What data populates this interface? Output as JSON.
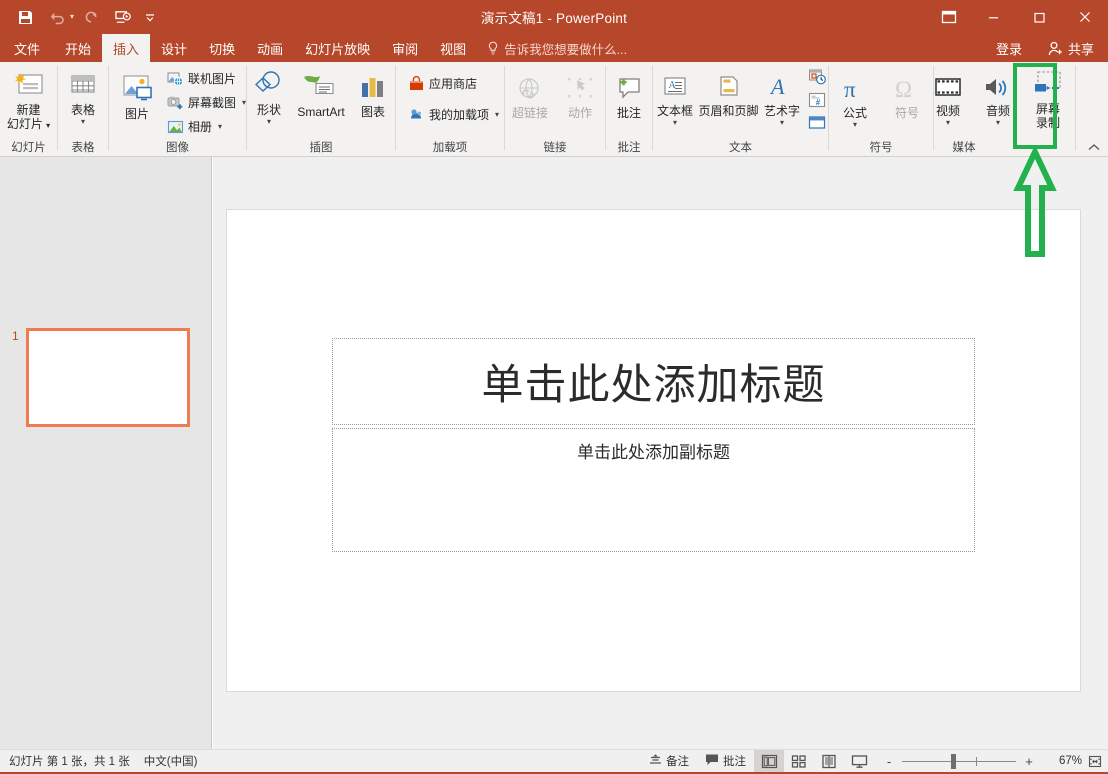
{
  "window": {
    "title": "演示文稿1 - PowerPoint",
    "accent_color": "#b7472a",
    "quick_access": [
      {
        "name": "save-button",
        "icon": "save-icon",
        "enabled": true
      },
      {
        "name": "undo-button",
        "icon": "undo-icon",
        "enabled": false
      },
      {
        "name": "redo-button",
        "icon": "redo-icon",
        "enabled": false
      },
      {
        "name": "start-from-beginning-button",
        "icon": "slideshow-icon",
        "enabled": true
      },
      {
        "name": "customize-quick-access-toolbar",
        "icon": "chevron-down-icon",
        "enabled": true
      }
    ],
    "controls": {
      "ribbon_display_options": "ribbon-display-options-icon",
      "minimize": "minimize-icon",
      "maximize": "maximize-icon",
      "close": "close-icon"
    }
  },
  "tabs": [
    {
      "label": "文件",
      "active": false
    },
    {
      "label": "开始",
      "active": false
    },
    {
      "label": "插入",
      "active": true
    },
    {
      "label": "设计",
      "active": false
    },
    {
      "label": "切换",
      "active": false
    },
    {
      "label": "动画",
      "active": false
    },
    {
      "label": "幻灯片放映",
      "active": false
    },
    {
      "label": "审阅",
      "active": false
    },
    {
      "label": "视图",
      "active": false
    }
  ],
  "tell_me": {
    "label": "告诉我您想要做什么...",
    "icon": "lightbulb-icon"
  },
  "account": {
    "signin_label": "登录",
    "share_label": "共享",
    "share_icon": "share-person-icon"
  },
  "ribbon": {
    "collapse_icon": "chevron-up-icon",
    "groups": [
      {
        "label": "幻灯片",
        "name": "ribbon-group-slides",
        "buttons": [
          {
            "name": "new-slide-button",
            "label1": "新建",
            "label2": "幻灯片",
            "icon": "new-slide-icon",
            "dropdown": true,
            "enabled": true
          }
        ]
      },
      {
        "label": "表格",
        "name": "ribbon-group-tables",
        "buttons": [
          {
            "name": "table-button",
            "label1": "表格",
            "label2": "",
            "icon": "table-icon",
            "dropdown": true,
            "enabled": true
          }
        ]
      },
      {
        "label": "图像",
        "name": "ribbon-group-images",
        "buttons": [
          {
            "name": "pictures-button",
            "label1": "图片",
            "label2": "",
            "icon": "picture-icon",
            "dropdown": false,
            "enabled": true
          }
        ],
        "small_buttons": [
          {
            "name": "online-pictures-button",
            "label": "联机图片",
            "icon": "online-pictures-icon",
            "dropdown": false
          },
          {
            "name": "screenshot-button",
            "label": "屏幕截图",
            "icon": "screenshot-icon",
            "dropdown": true
          },
          {
            "name": "photo-album-button",
            "label": "相册",
            "icon": "photo-album-icon",
            "dropdown": true
          }
        ]
      },
      {
        "label": "插图",
        "name": "ribbon-group-illustrations",
        "buttons": [
          {
            "name": "shapes-button",
            "label1": "形状",
            "label2": "",
            "icon": "shapes-icon",
            "dropdown": true,
            "enabled": true
          },
          {
            "name": "smartart-button",
            "label1": "SmartArt",
            "label2": "",
            "icon": "smartart-icon",
            "dropdown": false,
            "enabled": true
          },
          {
            "name": "chart-button",
            "label1": "图表",
            "label2": "",
            "icon": "chart-icon",
            "dropdown": false,
            "enabled": true
          }
        ]
      },
      {
        "label": "加载项",
        "name": "ribbon-group-addins",
        "small_buttons": [
          {
            "name": "store-button",
            "label": "应用商店",
            "icon": "store-icon",
            "dropdown": false
          },
          {
            "name": "my-addins-button",
            "label": "我的加载项",
            "icon": "my-addins-icon",
            "dropdown": true
          }
        ]
      },
      {
        "label": "链接",
        "name": "ribbon-group-links",
        "buttons": [
          {
            "name": "hyperlink-button",
            "label1": "超链接",
            "label2": "",
            "icon": "hyperlink-icon",
            "dropdown": false,
            "enabled": false
          },
          {
            "name": "action-button",
            "label1": "动作",
            "label2": "",
            "icon": "action-icon",
            "dropdown": false,
            "enabled": false
          }
        ]
      },
      {
        "label": "批注",
        "name": "ribbon-group-comments",
        "buttons": [
          {
            "name": "new-comment-button",
            "label1": "批注",
            "label2": "",
            "icon": "new-comment-icon",
            "dropdown": false,
            "enabled": true
          }
        ]
      },
      {
        "label": "文本",
        "name": "ribbon-group-text",
        "buttons": [
          {
            "name": "text-box-button",
            "label1": "文本框",
            "label2": "",
            "icon": "text-box-icon",
            "dropdown": true,
            "enabled": true
          },
          {
            "name": "header-footer-button",
            "label1": "页眉和页脚",
            "label2": "",
            "icon": "header-footer-icon",
            "dropdown": false,
            "enabled": true
          },
          {
            "name": "wordart-button",
            "label1": "艺术字",
            "label2": "",
            "icon": "wordart-icon",
            "dropdown": true,
            "enabled": true
          }
        ],
        "tiny_buttons": [
          {
            "name": "date-and-time-button",
            "icon": "date-time-icon"
          },
          {
            "name": "slide-number-button",
            "icon": "slide-number-icon"
          },
          {
            "name": "object-button",
            "icon": "object-icon"
          }
        ]
      },
      {
        "label": "符号",
        "name": "ribbon-group-symbols",
        "buttons": [
          {
            "name": "equation-button",
            "label1": "公式",
            "label2": "",
            "icon": "equation-pi-icon",
            "dropdown": true,
            "enabled": true
          },
          {
            "name": "symbol-button",
            "label1": "符号",
            "label2": "",
            "icon": "symbol-omega-icon",
            "dropdown": false,
            "enabled": false
          }
        ]
      },
      {
        "label": "媒体",
        "name": "ribbon-group-media",
        "buttons": [
          {
            "name": "video-button",
            "label1": "视频",
            "label2": "",
            "icon": "video-icon",
            "dropdown": true,
            "enabled": true
          },
          {
            "name": "audio-button",
            "label1": "音频",
            "label2": "",
            "icon": "audio-speaker-icon",
            "dropdown": true,
            "enabled": true
          },
          {
            "name": "screen-recording-button",
            "label1": "屏幕",
            "label2": "录制",
            "icon": "screen-recording-icon",
            "dropdown": false,
            "enabled": true,
            "highlighted": true
          }
        ]
      }
    ]
  },
  "annotation": {
    "color": "#22b14c",
    "highlight_target": "screen-recording-button",
    "arrow_direction": "up"
  },
  "slides_pane": {
    "slides": [
      {
        "number": "1",
        "selected": true,
        "selection_color": "#ed7d4f"
      }
    ]
  },
  "slide": {
    "title_placeholder": "单击此处添加标题",
    "subtitle_placeholder": "单击此处添加副标题"
  },
  "status_bar": {
    "slide_counter": "幻灯片 第 1 张，共 1 张",
    "language": "中文(中国)",
    "notes_label": "备注",
    "notes_icon": "notes-icon",
    "comments_label": "批注",
    "comments_icon": "comment-icon",
    "views": [
      {
        "name": "normal-view-button",
        "icon": "normal-view-icon",
        "active": true
      },
      {
        "name": "slide-sorter-view-button",
        "icon": "slide-sorter-icon",
        "active": false
      },
      {
        "name": "reading-view-button",
        "icon": "reading-view-icon",
        "active": false
      },
      {
        "name": "slideshow-view-button",
        "icon": "slideshow-view-icon",
        "active": false
      }
    ],
    "zoom_out": "-",
    "zoom_in": "+",
    "zoom_level": "67%",
    "fit_to_window_icon": "fit-to-window-icon"
  }
}
